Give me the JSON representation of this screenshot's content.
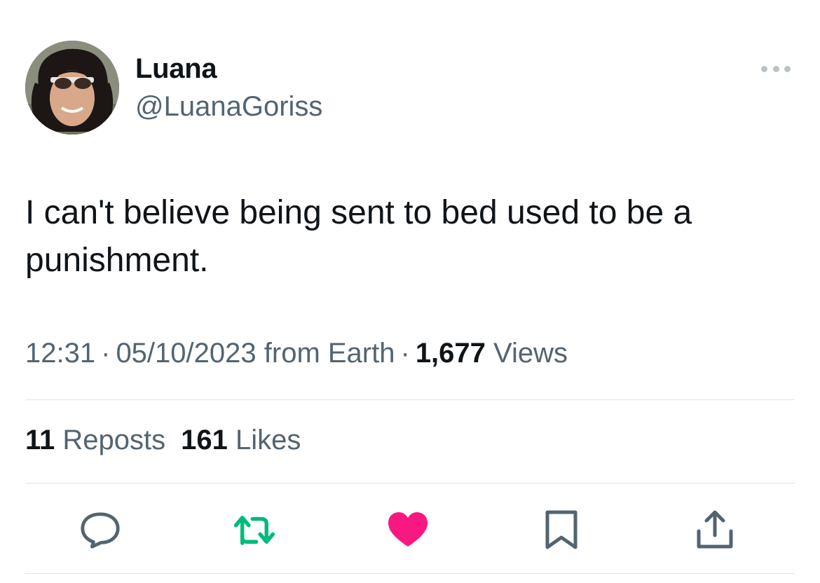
{
  "user": {
    "display_name": "Luana",
    "handle": "@LuanaGoriss"
  },
  "tweet": {
    "text": "I can't believe being sent to bed used to be a punishment."
  },
  "meta": {
    "time": "12:31",
    "separator": "·",
    "date": "05/10/2023",
    "source": "from Earth",
    "views_count": "1,677",
    "views_label": "Views"
  },
  "stats": {
    "reposts_count": "11",
    "reposts_label": "Reposts",
    "likes_count": "161",
    "likes_label": "Likes"
  },
  "actions": {
    "reply_icon": "speech-bubble-icon",
    "repost_icon": "repost-arrows-icon",
    "like_icon": "heart-icon",
    "bookmark_icon": "bookmark-icon",
    "share_icon": "share-upload-icon"
  },
  "colors": {
    "repost_green": "#00ba7c",
    "like_pink": "#f91880",
    "secondary_text": "#536471"
  }
}
